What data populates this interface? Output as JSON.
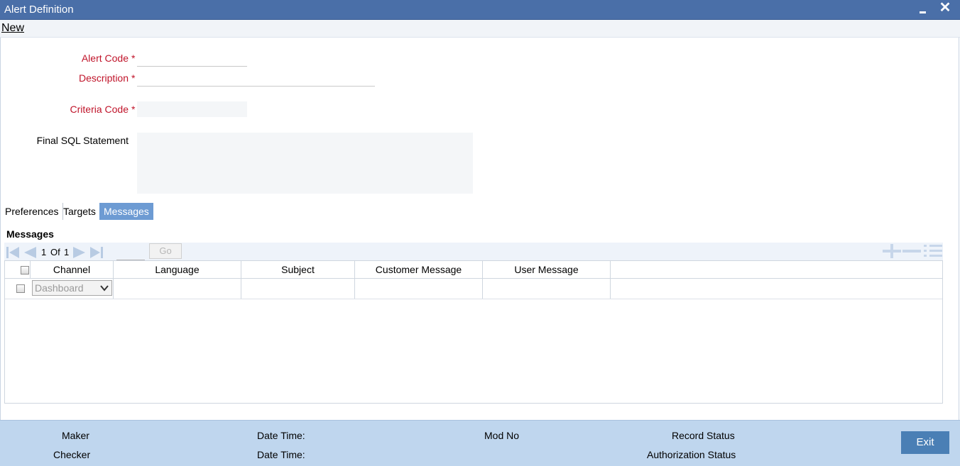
{
  "window": {
    "title": "Alert Definition"
  },
  "menu": {
    "new_label": "New"
  },
  "form": {
    "alert_code_label": "Alert Code",
    "description_label": "Description",
    "criteria_code_label": "Criteria Code",
    "final_sql_label": "Final SQL Statement",
    "required_mark": "*"
  },
  "tabs": [
    {
      "label": "Preferences"
    },
    {
      "label": "Targets"
    },
    {
      "label": "Messages"
    }
  ],
  "messages": {
    "section_title": "Messages",
    "pagination": {
      "current": "1",
      "of_label": "Of",
      "total": "1",
      "go_label": "Go"
    },
    "columns": [
      "Channel",
      "Language",
      "Subject",
      "Customer Message",
      "User Message"
    ],
    "rows": [
      {
        "channel": "Dashboard"
      }
    ]
  },
  "footer": {
    "maker_label": "Maker",
    "checker_label": "Checker",
    "date_time_label": "Date Time:",
    "mod_no_label": "Mod No",
    "record_status_label": "Record Status",
    "authorization_status_label": "Authorization Status",
    "exit_label": "Exit"
  },
  "colors": {
    "titlebar": "#4a6fa8",
    "active_tab": "#6d9bd3",
    "footer": "#bfd6ee",
    "required": "#c0142a",
    "exit_button": "#4a7fb5"
  },
  "icons": [
    "minimize-icon",
    "close-icon",
    "first-page-icon",
    "prev-page-icon",
    "next-page-icon",
    "last-page-icon",
    "add-row-icon",
    "delete-row-icon",
    "single-view-icon",
    "dropdown-arrow-icon"
  ]
}
